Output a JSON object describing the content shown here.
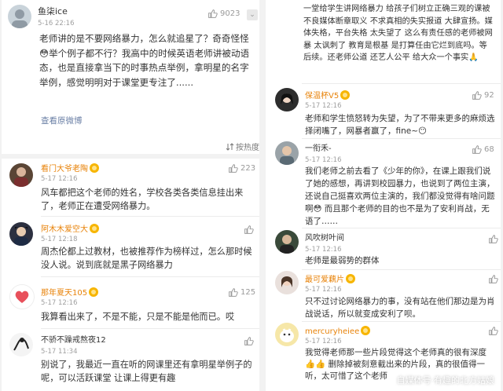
{
  "left": {
    "top_post": {
      "name": "鱼柒ice",
      "date": "5-16 22:16",
      "likes": "9023",
      "text": "老师讲的是不要网络暴力，怎么就追星了？奇奇怪怪😳举个例子都不行？我高中的时候英语老师讲被动语态，也是直接拿当下的时事热点举例，拿明星的名字举例，感觉明明对于课堂更专注了......",
      "view_original": "查看原微博",
      "sort_label": "按热度"
    },
    "comments": [
      {
        "name": "看门大爷老陶",
        "date": "5-17 12:16",
        "likes": "223",
        "text": "风车都把这个老师的姓名，学校各类各类信息挂出来了，老师正在遭受网络暴力。"
      },
      {
        "name": "阿木木爱空大",
        "date": "5-17 12:18",
        "likes": "",
        "text": "周杰伦都上过教材，也被推荐作为榜样过，怎么那时候没人说。说到底就是黑子网络暴力"
      },
      {
        "name": "那年夏天105",
        "date": "5-17 12:16",
        "likes": "125",
        "text": "我算看出来了，不是不能，只是不能是他而已。哎"
      },
      {
        "name": "不骄不躁戒熬夜12",
        "date": "5-17 11:34",
        "likes": "",
        "text": "别说了，我最近一直在听的网课里还有拿明星举例子的呢，可以活跃课堂 让课上得更有趣"
      }
    ]
  },
  "right": {
    "top_text": "一堂给学生讲网络暴力 给孩子们树立正确三观的课被不良媒体断章取义 不求真相的失实报道 大肆宣扬。媒体失格，平台失格 太失望了 这么有责任感的老师被网暴 太讽刺了 教育是根基 是打算任由它烂到底吗。等后续。还老师公道 还艺人公平 给大众一个事实🙏",
    "comments": [
      {
        "name": "保温杯V5",
        "date": "5-17 12:16",
        "likes": "92",
        "text": "老师和学生愤怒转为失望，为了不带来更多的麻烦选择闭嘴了，网暴者赢了，fine~😶"
      },
      {
        "name": "一衔禾-",
        "date": "5-17 12:16",
        "likes": "68",
        "text": "我们老师之前去看了《少年的你》，在课上跟我们说了她的感想，再讲到校园暴力，也说到了两位主演，还说自己挺喜欢两位主演的，我们都没觉得有啥问题啊😳 而且那个老师的目的也不是为了安利肖战，无语了……"
      },
      {
        "name": "风吹树叶间",
        "date": "5-17 12:16",
        "likes": "",
        "text": "老师是最弱势的群体"
      },
      {
        "name": "最可爱藕片",
        "date": "5-17 12:16",
        "likes": "",
        "text": "只不过讨论网络暴力的事，没有站在他们那边是为肖战说话，所以就变成安利了呗。"
      },
      {
        "name": "mercuryheiee",
        "date": "5-17 12:16",
        "likes": "",
        "text": "我觉得老师那一些片段觉得这个老师真的很有深度👍👍 删除掉被刻意截出来的片段，真的很值得一听，太可惜了这个老师"
      }
    ],
    "watermark": "自媒体号·有趣的北方姑娘"
  },
  "colors": {
    "orange_name": "#e8830a",
    "link": "#6a7fa5",
    "badge": "#f7b500"
  }
}
